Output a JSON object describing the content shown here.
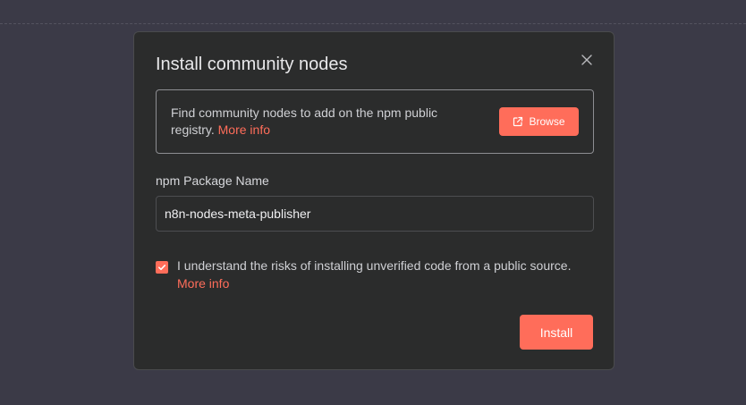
{
  "modal": {
    "title": "Install community nodes",
    "close_icon": "close-icon"
  },
  "info": {
    "text": "Find community nodes to add on the npm public registry.",
    "more_info": "More info",
    "browse_label": "Browse",
    "browse_icon": "external-link-icon"
  },
  "package": {
    "label": "npm Package Name",
    "value": "n8n-nodes-meta-publisher"
  },
  "consent": {
    "checked": true,
    "text": "I understand the risks of installing unverified code from a public source.",
    "more_info": "More info"
  },
  "actions": {
    "install_label": "Install"
  },
  "colors": {
    "accent": "#ff6d5a",
    "modal_bg": "#2b2c2c",
    "page_bg": "#3b3a47"
  }
}
